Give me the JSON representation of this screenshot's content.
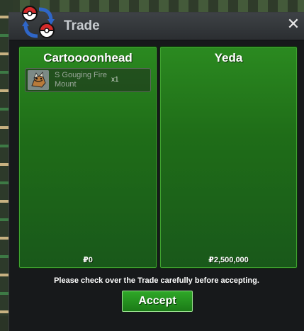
{
  "window": {
    "title": "Trade",
    "close_icon": "close-icon",
    "trade_icon": "trade-swap-icon"
  },
  "left_party": {
    "name": "Cartoooonhead",
    "money": "₽0",
    "items": [
      {
        "name": "S Gouging Fire Mount",
        "quantity": "x1",
        "icon": "gouging-fire-mount-icon"
      }
    ]
  },
  "right_party": {
    "name": "Yeda",
    "money": "₽2,500,000",
    "items": []
  },
  "footer": {
    "notice": "Please check over the Trade carefully before accepting.",
    "accept_label": "Accept"
  },
  "colors": {
    "panel_green": "#1f6d18",
    "button_green": "#2fa828",
    "window_bg": "#17191b",
    "titlebar": "#3e4246"
  }
}
